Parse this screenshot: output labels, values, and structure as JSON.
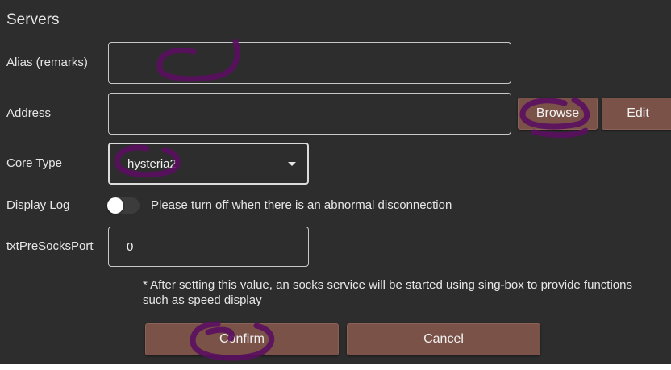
{
  "page": {
    "title": "Servers"
  },
  "form": {
    "alias": {
      "label": "Alias (remarks)",
      "value": ""
    },
    "address": {
      "label": "Address",
      "value": "",
      "browse_label": "Browse",
      "edit_label": "Edit"
    },
    "core_type": {
      "label": "Core Type",
      "value": "hysteria2"
    },
    "display_log": {
      "label": "Display Log",
      "enabled": false,
      "hint": "Please turn off when there is an abnormal disconnection"
    },
    "pre_socks_port": {
      "label": "txtPreSocksPort",
      "value": "0",
      "note": "* After setting this value, an socks service will be started using sing-box to provide functions such as speed display"
    }
  },
  "actions": {
    "confirm_label": "Confirm",
    "cancel_label": "Cancel"
  },
  "colors": {
    "background": "#2d2d2d",
    "button": "#7a5248",
    "annotation": "#5a0f5f"
  }
}
